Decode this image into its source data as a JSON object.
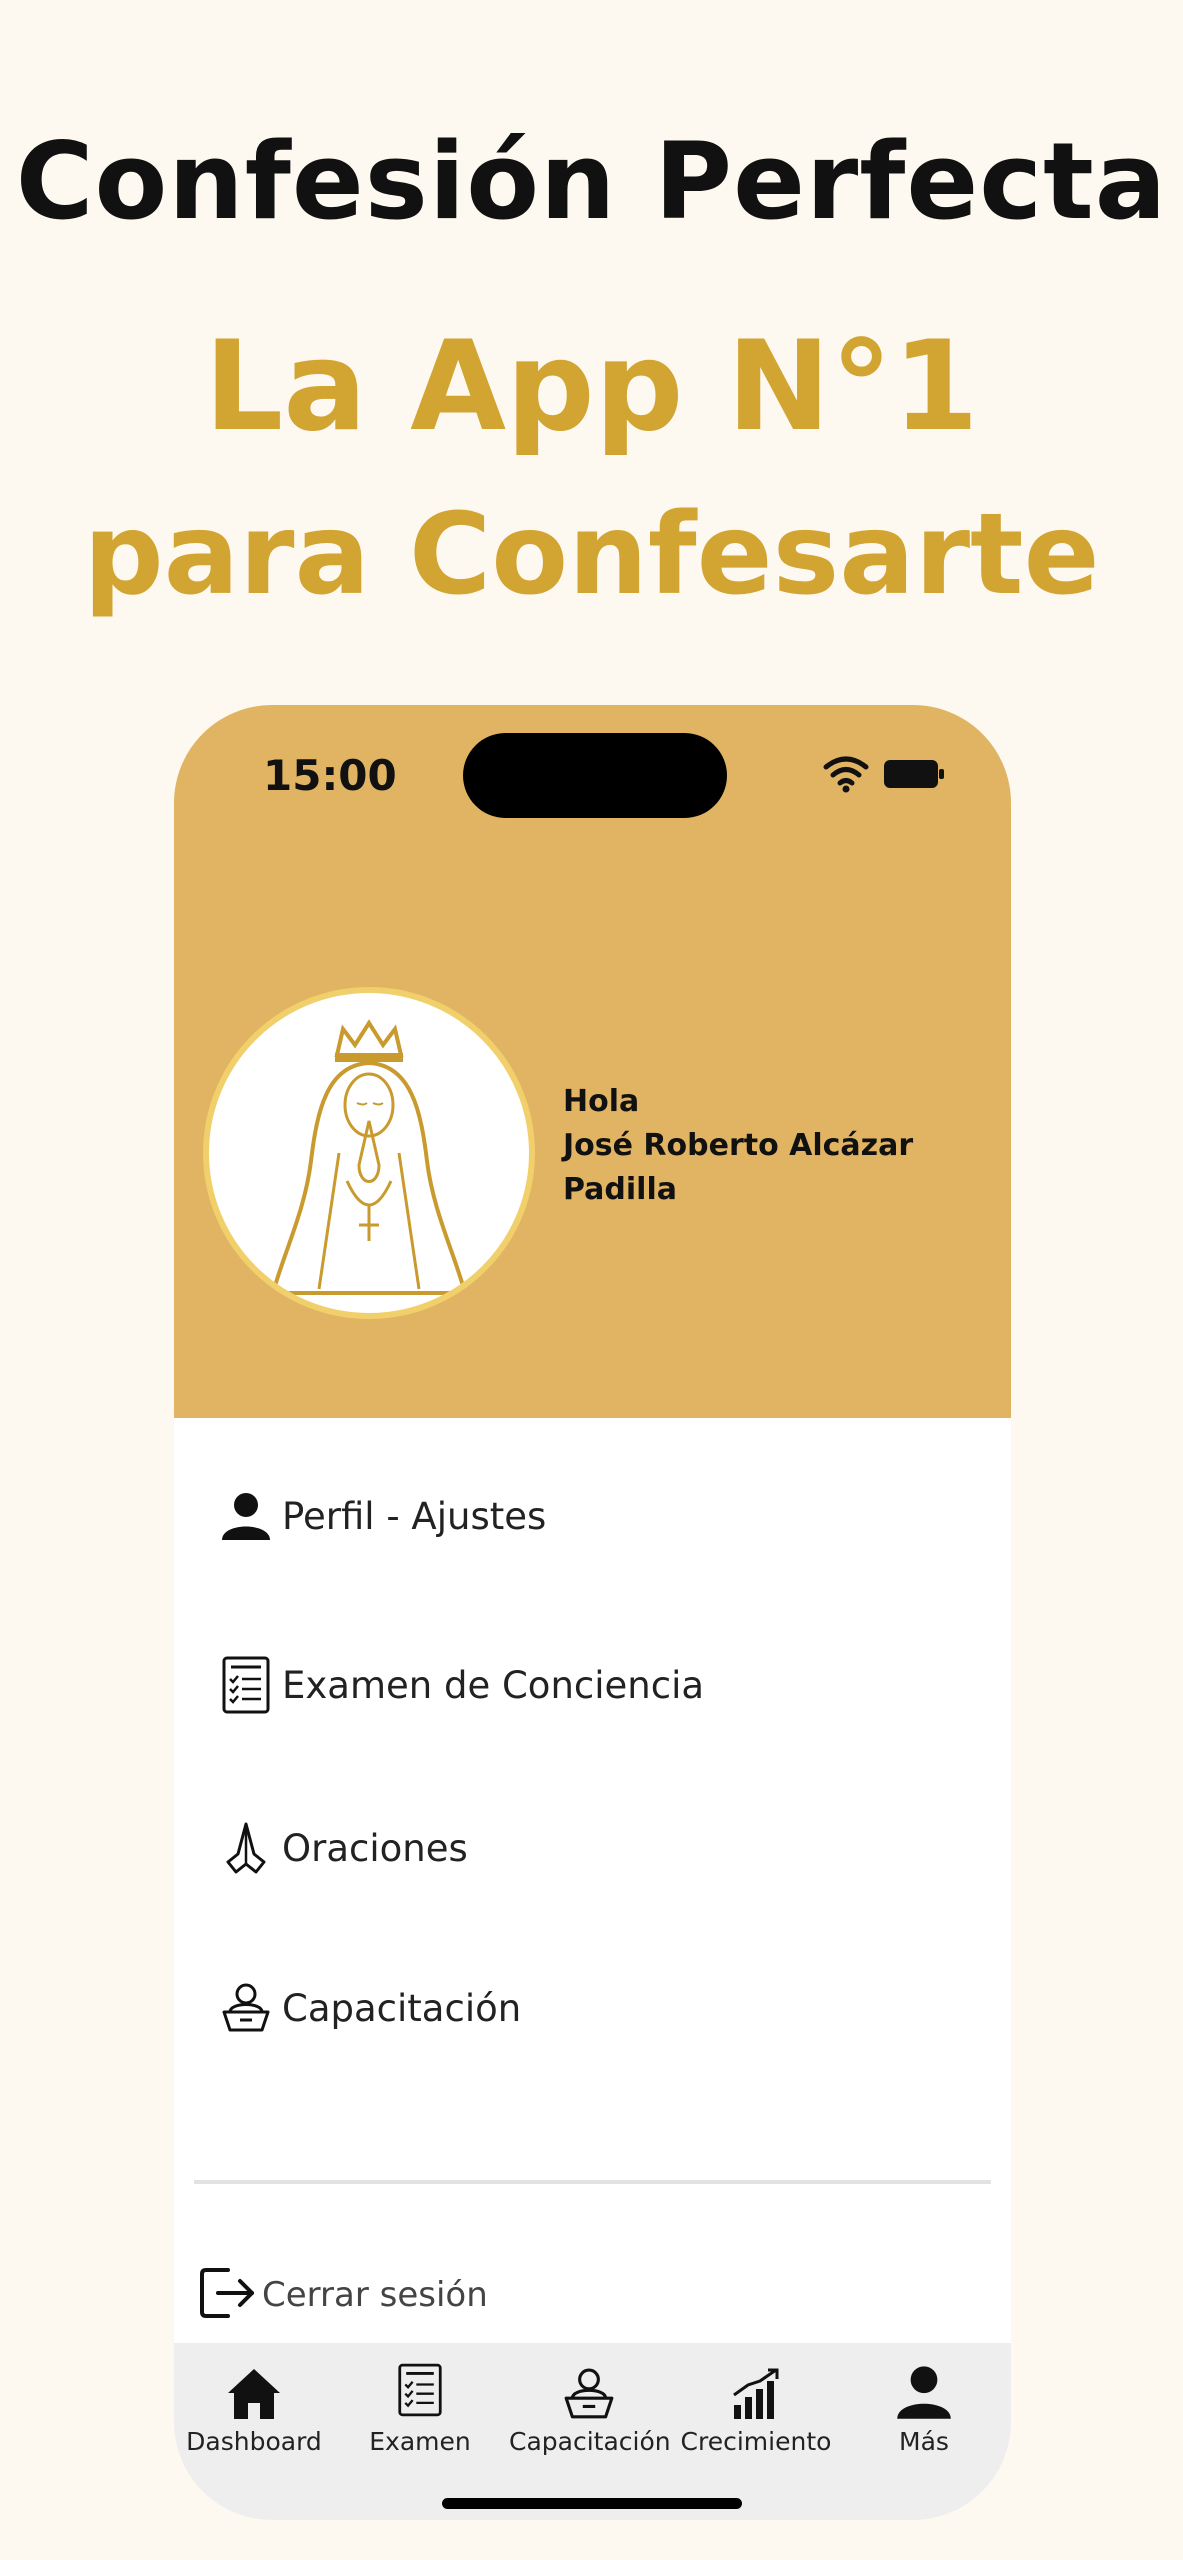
{
  "promo": {
    "title": "Confesión Perfecta",
    "line1": "La App N°1",
    "line2": "para Confesarte"
  },
  "status_bar": {
    "time": "15:00",
    "icons": [
      "wifi-icon",
      "battery-icon"
    ]
  },
  "profile": {
    "greeting": "Hola",
    "name": "José Roberto Alcázar Padilla"
  },
  "menu": {
    "items": [
      {
        "label": "Perfil - Ajustes",
        "icon": "person-icon"
      },
      {
        "label": "Examen de Conciencia",
        "icon": "checklist-icon"
      },
      {
        "label": "Oraciones",
        "icon": "praying-hands-icon"
      },
      {
        "label": "Capacitación",
        "icon": "teacher-icon"
      }
    ],
    "logout_label": "Cerrar sesión"
  },
  "tabbar": {
    "items": [
      {
        "label": "Dashboard",
        "icon": "home-icon"
      },
      {
        "label": "Examen",
        "icon": "checklist-icon"
      },
      {
        "label": "Capacitación",
        "icon": "teacher-icon"
      },
      {
        "label": "Crecimiento",
        "icon": "growth-chart-icon"
      },
      {
        "label": "Más",
        "icon": "person-icon"
      }
    ]
  },
  "colors": {
    "accent_gold": "#d2a431",
    "header_gold": "#e0b463",
    "background": "#fdf9f1"
  }
}
